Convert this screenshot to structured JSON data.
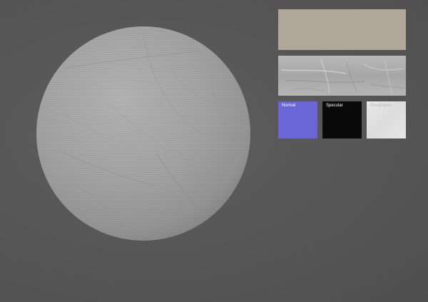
{
  "viewport": {
    "background_color": "#575757"
  },
  "preview": {
    "object": "sphere",
    "surface_color": "#a3a3a3",
    "surface": "wrinkled-fabric"
  },
  "texture_maps": {
    "albedo": {
      "color": "#b0a799"
    },
    "displacement": {
      "color": "#b0b0b0"
    },
    "normal": {
      "label": "Normal",
      "color": "#6b66d8"
    },
    "specular": {
      "label": "Specular",
      "color": "#0a0a0a"
    },
    "roughness": {
      "label": "Roughness",
      "color": "#e4e4e4"
    }
  }
}
